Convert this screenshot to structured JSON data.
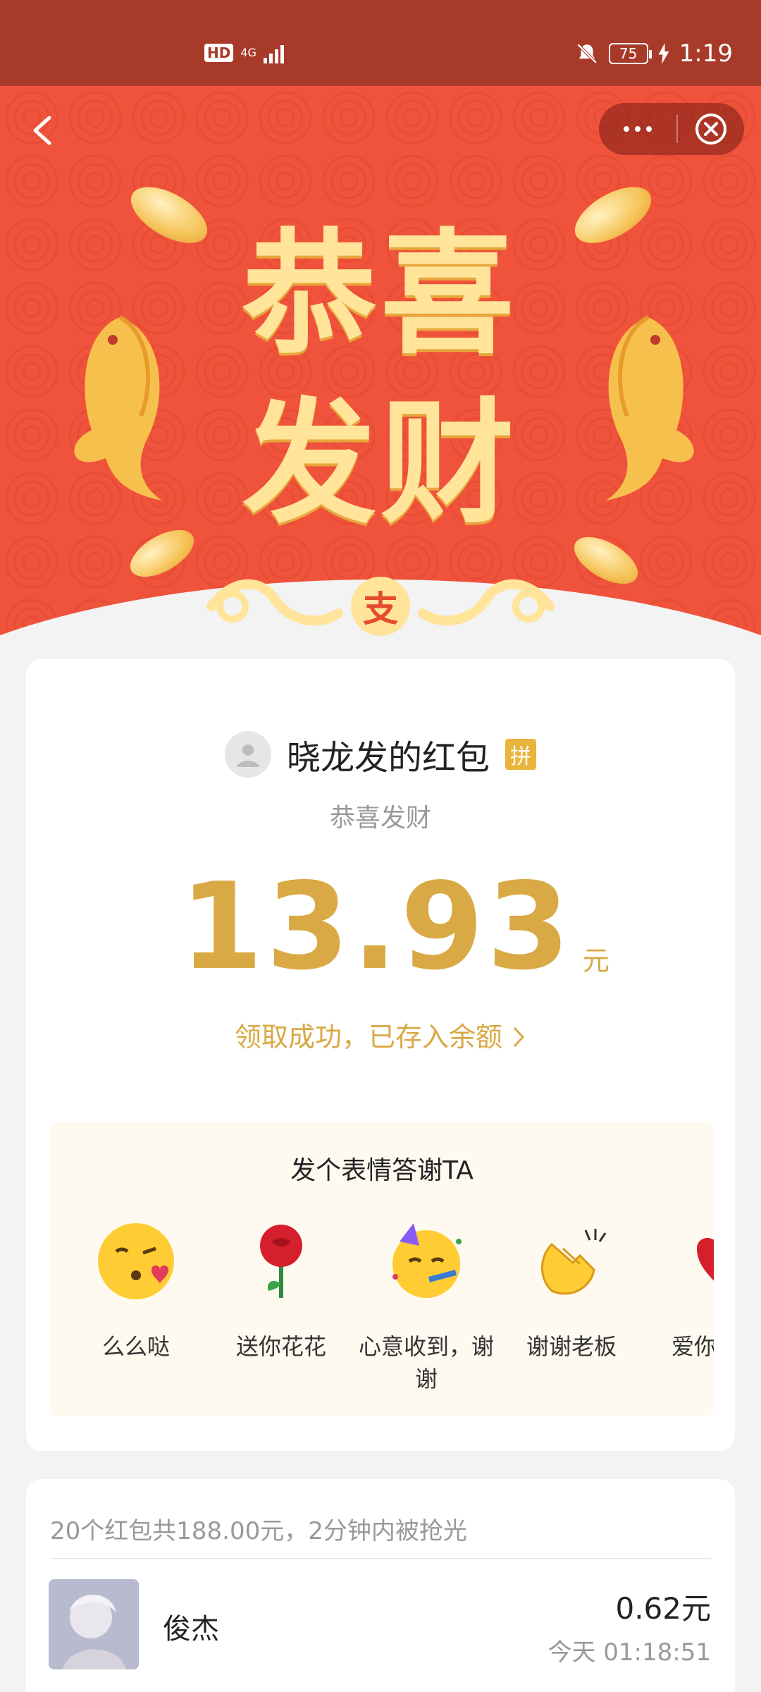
{
  "status_bar": {
    "hd": "HD",
    "network": "4G",
    "battery": "75",
    "time": "1:19"
  },
  "hero": {
    "title_line1": "恭喜",
    "title_line2": "发财",
    "emblem": "支"
  },
  "card": {
    "sender": "晓龙发的红包",
    "group_badge": "拼",
    "blessing": "恭喜发财",
    "amount": "13.93",
    "unit": "元",
    "deposit_link": "领取成功，已存入余额",
    "emoji_title": "发个表情答谢TA",
    "emojis": [
      {
        "label": "么么哒",
        "icon": "kissing-face-icon"
      },
      {
        "label": "送你花花",
        "icon": "rose-icon"
      },
      {
        "label": "心意收到，谢谢",
        "icon": "party-face-icon"
      },
      {
        "label": "谢谢老板",
        "icon": "clapping-hands-icon"
      },
      {
        "label": "爱你么么",
        "icon": "red-hearts-icon"
      }
    ]
  },
  "records": {
    "summary": "20个红包共188.00元，2分钟内被抢光",
    "items": [
      {
        "name": "俊杰",
        "amount": "0.62元",
        "time": "今天 01:18:51"
      }
    ]
  },
  "colors": {
    "status_bar": "#a83a2a",
    "hero_red": "#f0533b",
    "gold_text": "#ffe49a",
    "amount_gold": "#d9a945"
  }
}
